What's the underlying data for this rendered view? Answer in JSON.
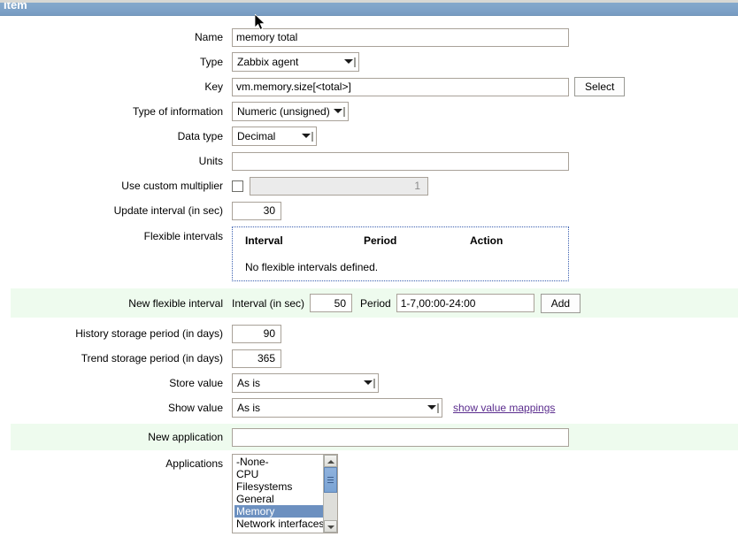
{
  "window": {
    "title": "Item"
  },
  "form": {
    "name": {
      "label": "Name",
      "value": "memory total",
      "placeholder": ""
    },
    "type": {
      "label": "Type",
      "value": "Zabbix agent"
    },
    "key": {
      "label": "Key",
      "value": "vm.memory.size[<total>]",
      "placeholder": "",
      "select_button": "Select"
    },
    "type_of_information": {
      "label": "Type of information",
      "value": "Numeric (unsigned)"
    },
    "data_type": {
      "label": "Data type",
      "value": "Decimal"
    },
    "units": {
      "label": "Units",
      "value": "",
      "placeholder": ""
    },
    "use_custom_multiplier": {
      "label": "Use custom multiplier",
      "checked": false,
      "value": "1"
    },
    "update_interval": {
      "label": "Update interval (in sec)",
      "value": "30"
    },
    "flexible_intervals": {
      "label": "Flexible intervals",
      "columns": [
        "Interval",
        "Period",
        "Action"
      ],
      "empty_text": "No flexible intervals defined."
    },
    "new_flexible_interval": {
      "label": "New flexible interval",
      "interval_label": "Interval (in sec)",
      "interval_value": "50",
      "period_label": "Period",
      "period_value": "1-7,00:00-24:00",
      "add_button": "Add"
    },
    "history_storage_period": {
      "label": "History storage period (in days)",
      "value": "90"
    },
    "trend_storage_period": {
      "label": "Trend storage period (in days)",
      "value": "365"
    },
    "store_value": {
      "label": "Store value",
      "value": "As is"
    },
    "show_value": {
      "label": "Show value",
      "value": "As is",
      "link": "show value mappings"
    },
    "new_application": {
      "label": "New application",
      "value": "",
      "placeholder": ""
    },
    "applications": {
      "label": "Applications",
      "options": [
        {
          "label": "-None-",
          "selected": false
        },
        {
          "label": "CPU",
          "selected": false
        },
        {
          "label": "Filesystems",
          "selected": false
        },
        {
          "label": "General",
          "selected": false
        },
        {
          "label": "Memory",
          "selected": true
        },
        {
          "label": "Network interfaces",
          "selected": false
        }
      ]
    }
  },
  "colors": {
    "header_bar": "#7fa3c8",
    "row_highlight": "#eefbee",
    "selection": "#6c90c0",
    "link": "#5b2d8e",
    "dotted_border": "#3a5fb0"
  }
}
